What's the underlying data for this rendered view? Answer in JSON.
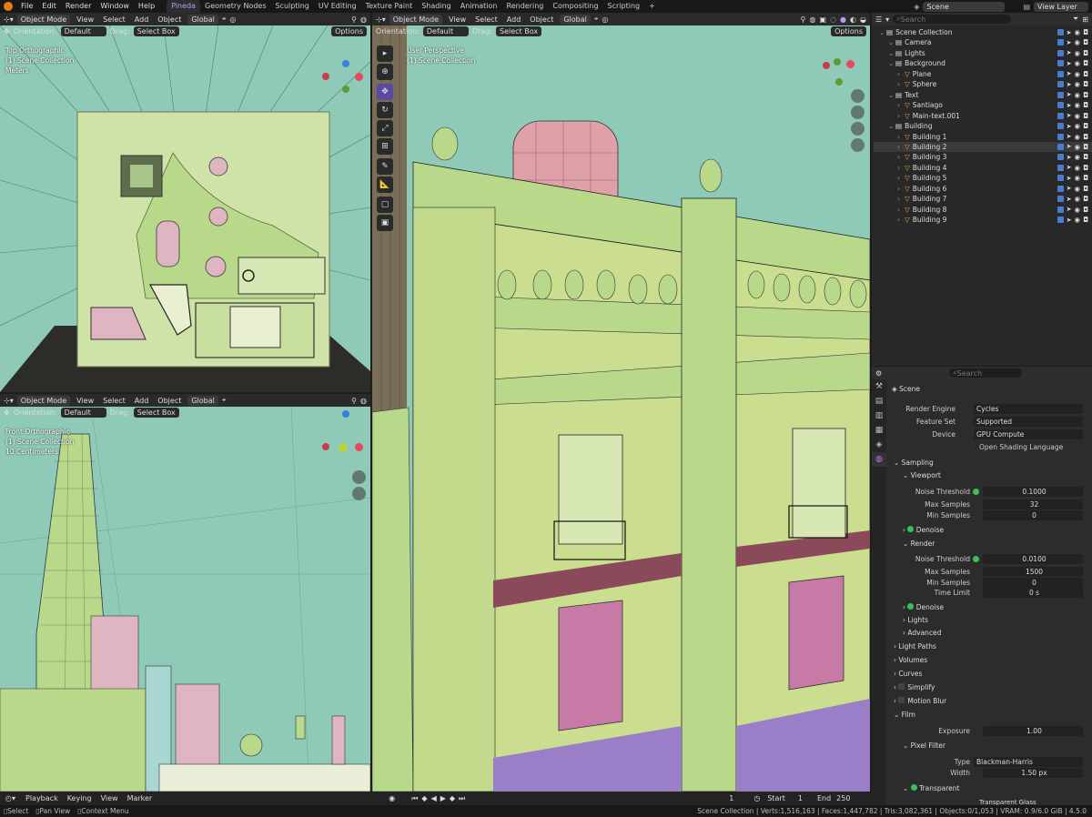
{
  "menu": [
    "File",
    "Edit",
    "Render",
    "Window",
    "Help"
  ],
  "workspaces": [
    {
      "label": "Pineda",
      "active": true
    },
    {
      "label": "Geometry Nodes",
      "active": false
    },
    {
      "label": "Sculpting",
      "active": false
    },
    {
      "label": "UV Editing",
      "active": false
    },
    {
      "label": "Texture Paint",
      "active": false
    },
    {
      "label": "Shading",
      "active": false
    },
    {
      "label": "Animation",
      "active": false
    },
    {
      "label": "Rendering",
      "active": false
    },
    {
      "label": "Compositing",
      "active": false
    },
    {
      "label": "Scripting",
      "active": false
    }
  ],
  "add_workspace": "+",
  "scene_name": "Scene",
  "view_layer": "View Layer",
  "vp_header": {
    "mode": "Object Mode",
    "view": "View",
    "select": "Select",
    "add": "Add",
    "object": "Object",
    "transform": "Global"
  },
  "vp_sub": {
    "orientation": "Orientation:",
    "orientation_val": "Default",
    "drag": "Drag:",
    "drag_val": "Select Box",
    "options": "Options"
  },
  "vp_top": {
    "title": "Top Orthographic",
    "collection": "(1) Scene Collection",
    "units": "Meters"
  },
  "vp_front": {
    "title": "Front Orthographic",
    "collection": "(1) Scene Collection",
    "units": "10 Centimeters"
  },
  "vp_persp": {
    "title": "User Perspective",
    "collection": "(1) Scene Collection"
  },
  "outliner": {
    "search_placeholder": "Search",
    "items": [
      {
        "label": "Scene Collection",
        "indent": 0
      },
      {
        "label": "Camera",
        "indent": 1
      },
      {
        "label": "Lights",
        "indent": 1
      },
      {
        "label": "Background",
        "indent": 1
      },
      {
        "label": "Plane",
        "indent": 2
      },
      {
        "label": "Sphere",
        "indent": 2
      },
      {
        "label": "Text",
        "indent": 1
      },
      {
        "label": "Santiago",
        "indent": 2
      },
      {
        "label": "Main-text.001",
        "indent": 2
      },
      {
        "label": "Building",
        "indent": 1
      },
      {
        "label": "Building 1",
        "indent": 2
      },
      {
        "label": "Building 2",
        "indent": 2,
        "selected": true
      },
      {
        "label": "Building 3",
        "indent": 2
      },
      {
        "label": "Building 4",
        "indent": 2
      },
      {
        "label": "Building 5",
        "indent": 2
      },
      {
        "label": "Building 6",
        "indent": 2
      },
      {
        "label": "Building 7",
        "indent": 2
      },
      {
        "label": "Building 8",
        "indent": 2
      },
      {
        "label": "Building 9",
        "indent": 2
      }
    ]
  },
  "properties": {
    "search_placeholder": "Search",
    "context": "Scene",
    "render_engine_label": "Render Engine",
    "render_engine": "Cycles",
    "feature_set_label": "Feature Set",
    "feature_set": "Supported",
    "device_label": "Device",
    "device": "GPU Compute",
    "osl": "Open Shading Language",
    "sampling": "Sampling",
    "viewport": "Viewport",
    "noise_threshold_label": "Noise Threshold",
    "vp_noise_threshold": "0.1000",
    "max_samples_label": "Max Samples",
    "vp_max_samples": "32",
    "min_samples_label": "Min Samples",
    "vp_min_samples": "0",
    "denoise": "Denoise",
    "render": "Render",
    "r_noise_threshold": "0.0100",
    "r_max_samples": "1500",
    "r_min_samples": "0",
    "time_limit_label": "Time Limit",
    "time_limit": "0 s",
    "lights": "Lights",
    "advanced": "Advanced",
    "light_paths": "Light Paths",
    "volumes": "Volumes",
    "curves": "Curves",
    "simplify": "Simplify",
    "motion_blur": "Motion Blur",
    "film": "Film",
    "exposure_label": "Exposure",
    "exposure": "1.00",
    "pixel_filter": "Pixel Filter",
    "type_label": "Type",
    "type": "Blackman-Harris",
    "width_label": "Width",
    "width": "1.50 px",
    "transparent": "Transparent",
    "transparent_glass": "Transparent Glass"
  },
  "timeline": {
    "playback": "Playback",
    "keying": "Keying",
    "view": "View",
    "marker": "Marker",
    "current_frame": "1",
    "start_label": "Start",
    "start": "1",
    "end_label": "End",
    "end": "250"
  },
  "status": {
    "select": "Select",
    "pan": "Pan View",
    "context": "Context Menu",
    "stats": "Scene Collection | Verts:1,516,163 | Faces:1,447,782 | Tris:3,082,361 | Objects:0/1,053 | VRAM: 0.9/6.0 GiB | 4.5.0"
  },
  "colors": {
    "accent": "#5a4aa0",
    "viewport_bg": "#8fc9b8",
    "mesh": "#b9d98a",
    "pink": "#c77aa6"
  }
}
